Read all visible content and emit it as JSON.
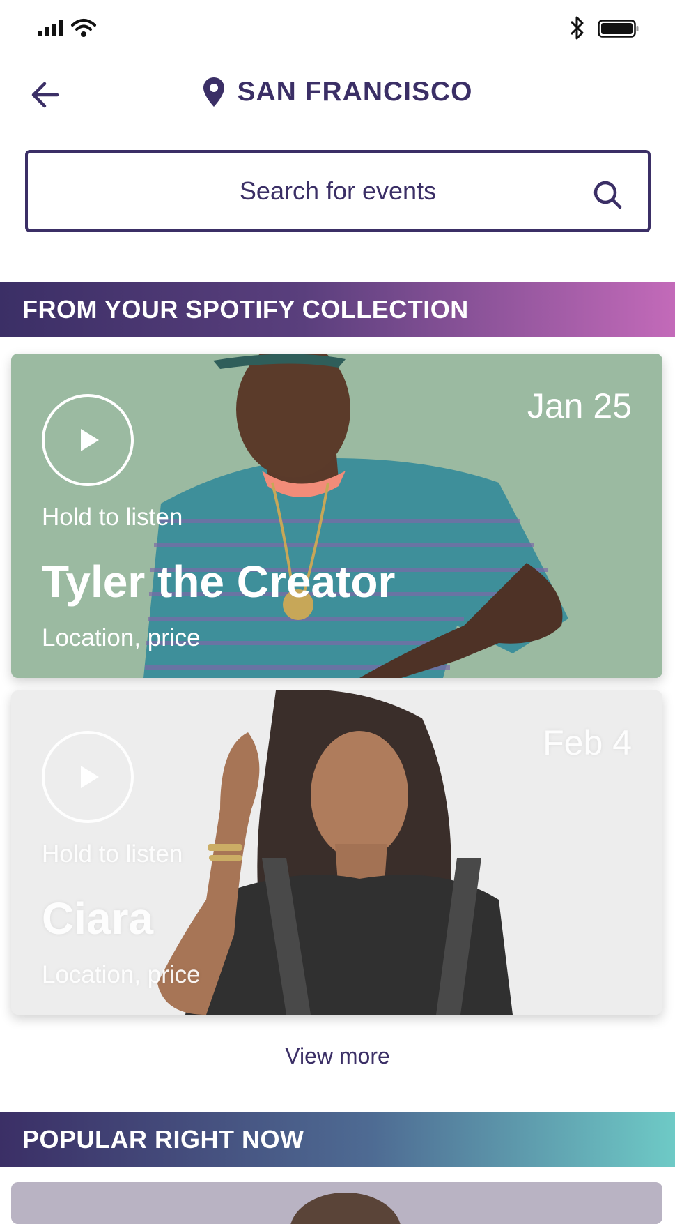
{
  "location": {
    "city": "SAN FRANCISCO"
  },
  "search": {
    "placeholder": "Search for events"
  },
  "sections": [
    {
      "title": "FROM YOUR SPOTIFY COLLECTION",
      "events": [
        {
          "artist": "Tyler the Creator",
          "date": "Jan 25",
          "hold_label": "Hold to listen",
          "meta": "Location, price"
        },
        {
          "artist": "Ciara",
          "date": "Feb 4",
          "hold_label": "Hold to listen",
          "meta": "Location, price"
        }
      ],
      "view_more": "View more"
    },
    {
      "title": "POPULAR RIGHT NOW"
    }
  ],
  "colors": {
    "brand": "#3b2f66",
    "spotify_gradient_end": "#c36ab9",
    "popular_gradient_end": "#6ecac6"
  }
}
